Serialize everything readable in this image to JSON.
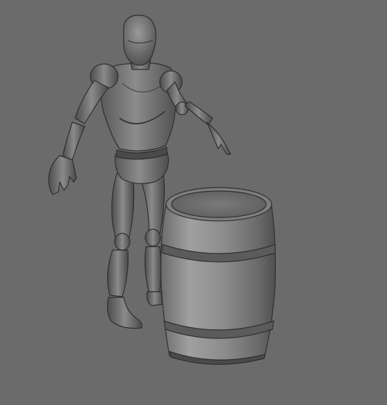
{
  "viewport": {
    "background": "#6b6b6b"
  },
  "scene": {
    "mannequin": {
      "shade_light": "#8f8f8f",
      "shade_mid": "#6f6f6f",
      "shade_dark": "#3f3f3f",
      "outline": "#2e2e2e"
    },
    "barrel": {
      "shade_light": "#9a9a9a",
      "shade_mid": "#747474",
      "shade_dark": "#4a4a4a",
      "hoop": "#5b5b5b",
      "outline": "#2f2f2f"
    }
  }
}
